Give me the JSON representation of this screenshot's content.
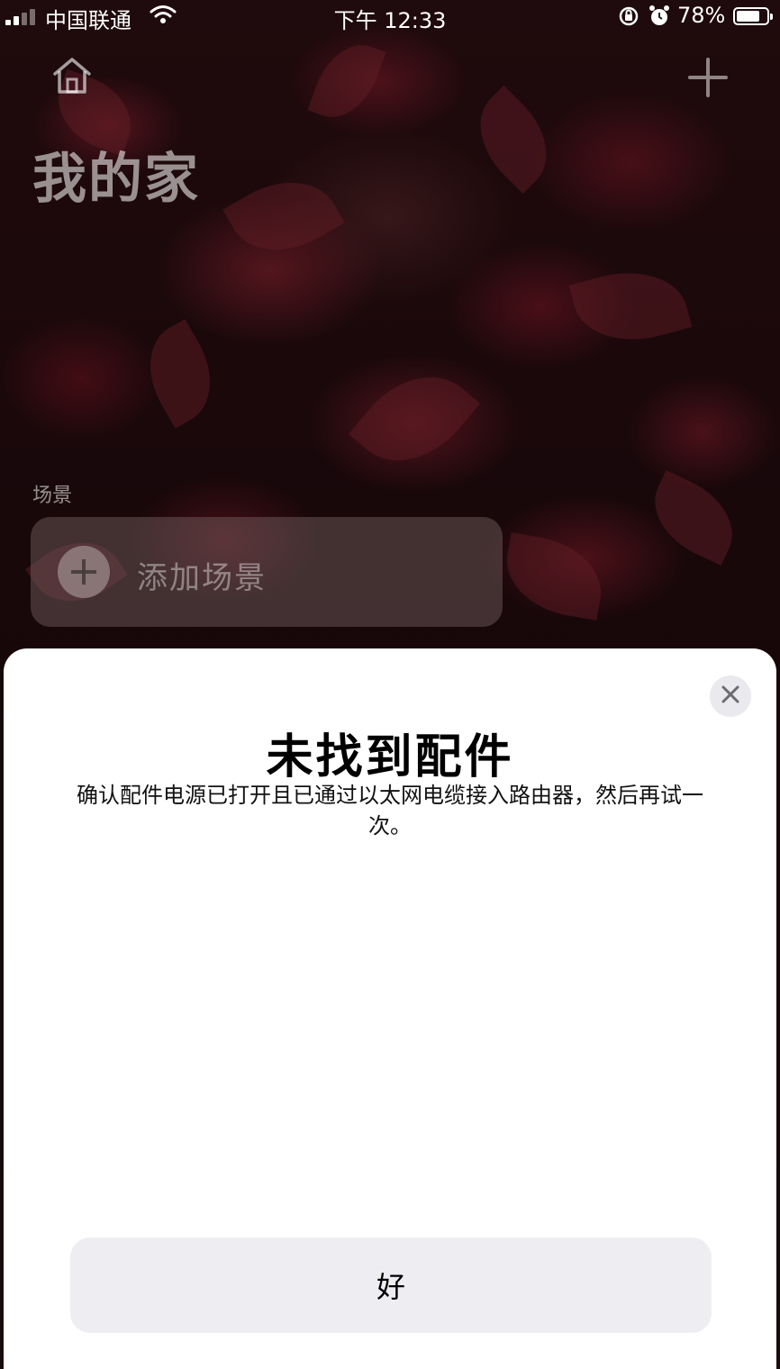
{
  "status_bar": {
    "carrier": "中国联通",
    "time": "下午 12:33",
    "battery_percent": "78%",
    "battery_level": 0.78
  },
  "home": {
    "title": "我的家",
    "scenes_label": "场景",
    "add_scene_label": "添加场景"
  },
  "dialog": {
    "title": "未找到配件",
    "message": "确认配件电源已打开且已通过以太网电缆接入路由器，然后再试一次。",
    "ok_label": "好"
  },
  "colors": {
    "sheet_background": "#ffffff",
    "button_background": "#eeeef2",
    "close_button_background": "#e9e9ee"
  },
  "icons": [
    "signal-icon",
    "wifi-icon",
    "rotation-lock-icon",
    "alarm-icon",
    "battery-icon",
    "home-icon",
    "plus-icon",
    "add-scene-plus-icon",
    "close-icon"
  ]
}
